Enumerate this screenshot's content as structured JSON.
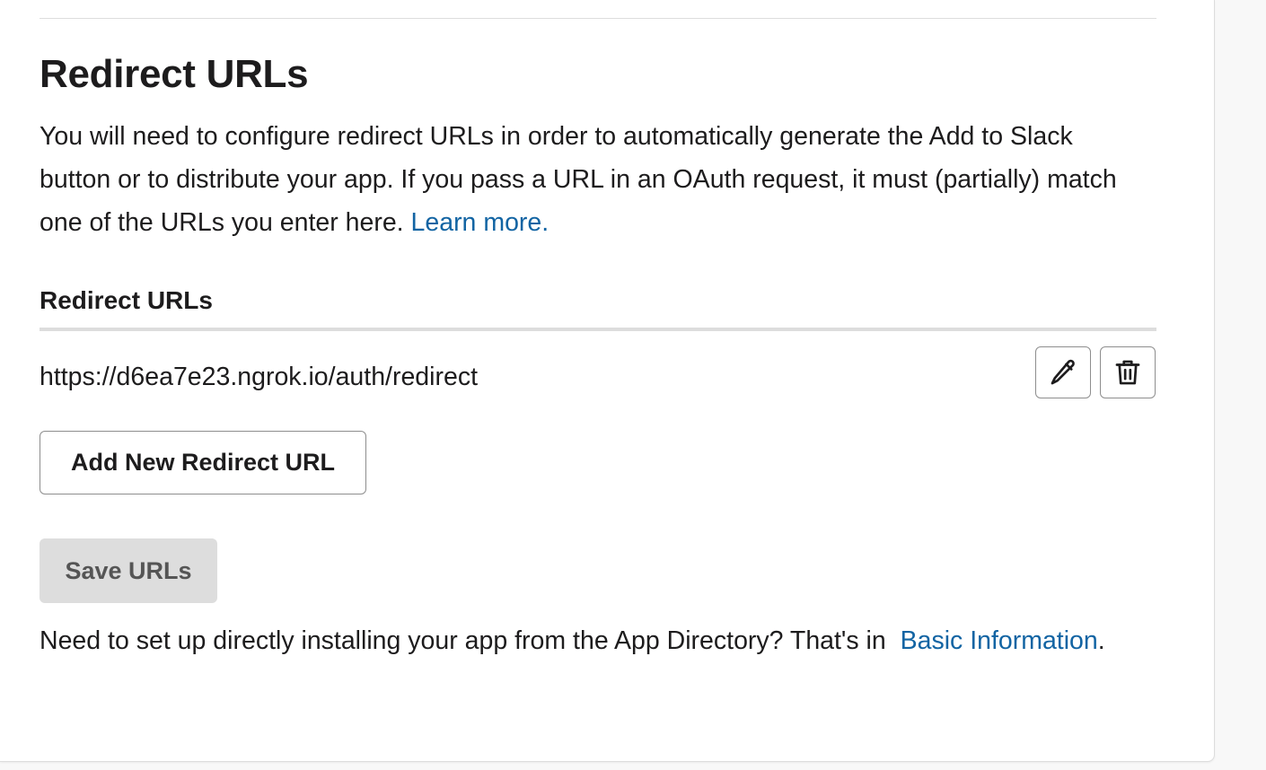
{
  "section": {
    "title": "Redirect URLs",
    "description": "You will need to configure redirect URLs in order to automatically generate the Add to Slack button or to distribute your app. If you pass a URL in an OAuth request, it must (partially) match one of the URLs you enter here.",
    "learn_more_link": "Learn more."
  },
  "redirect_list": {
    "heading": "Redirect URLs",
    "urls": [
      {
        "value": "https://d6ea7e23.ngrok.io/auth/redirect",
        "edit_icon": "pencil-icon",
        "delete_icon": "trash-icon"
      }
    ],
    "add_button_label": "Add New Redirect URL"
  },
  "save_button": {
    "label": "Save URLs",
    "state": "disabled"
  },
  "footer": {
    "text": "Need to set up directly installing your app from the App Directory? That's in",
    "link": "Basic Information",
    "suffix": "."
  },
  "colors": {
    "link": "#1264a3",
    "text": "#1d1c1d",
    "border": "#8e8e8e",
    "divider": "#dddddd",
    "disabled_button_bg": "#dddddd"
  }
}
